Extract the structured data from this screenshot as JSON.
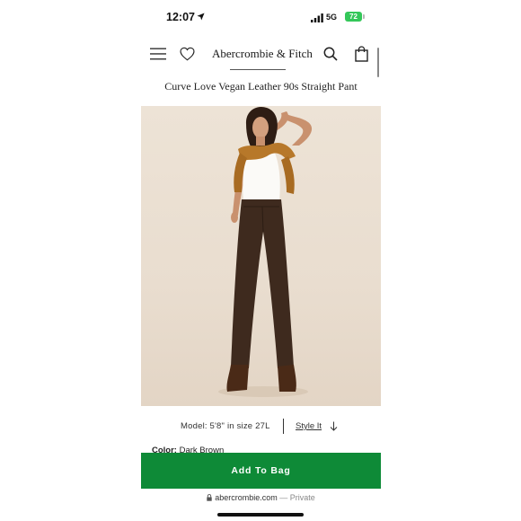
{
  "status_bar": {
    "time": "12:07",
    "network": "5G",
    "battery": "72"
  },
  "header": {
    "brand": "Abercrombie & Fitch"
  },
  "product": {
    "title": "Curve Love Vegan Leather 90s Straight Pant",
    "model_info": "Model: 5'8\" in size 27L",
    "style_it": "Style It",
    "color_label": "Color:",
    "color_value": "Dark Brown"
  },
  "actions": {
    "add_to_bag": "Add To Bag"
  },
  "browser": {
    "domain": "abercrombie.com",
    "privacy": "— Private"
  },
  "colors": {
    "accent_green": "#0e8a37",
    "battery_green": "#34c759",
    "pant_brown": "#3e2a1e",
    "sweater_tan": "#b7782a"
  }
}
